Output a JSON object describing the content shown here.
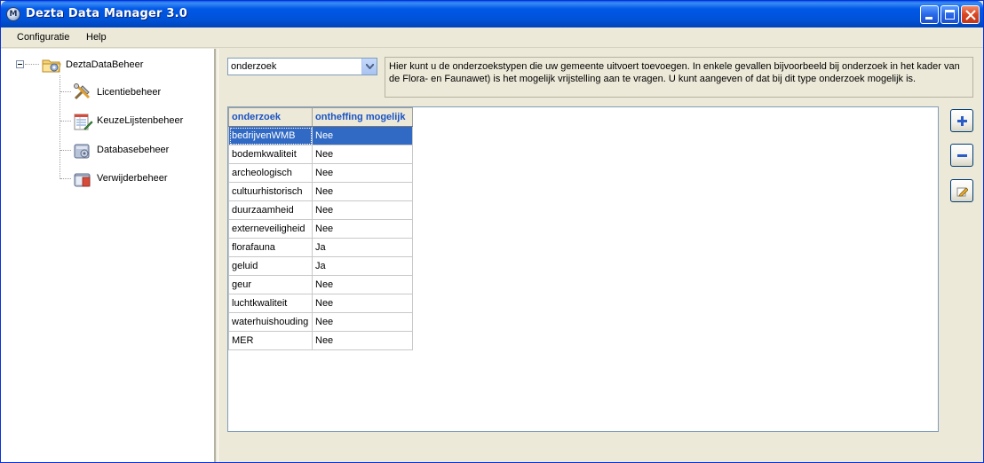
{
  "window": {
    "title": "Dezta Data Manager 3.0",
    "icon_letter": "M"
  },
  "menu": {
    "items": [
      "Configuratie",
      "Help"
    ]
  },
  "tree": {
    "root": "DeztaDataBeheer",
    "children": [
      "Licentiebeheer",
      "KeuzeLijstenbeheer",
      "Databasebeheer",
      "Verwijderbeheer"
    ]
  },
  "type_select": {
    "value": "onderzoek"
  },
  "info_text": "Hier kunt u de onderzoekstypen die uw gemeente uitvoert toevoegen. In enkele gevallen  bijvoorbeeld bij onderzoek in het kader van de Flora- en Faunawet) is het mogelijk vrijstelling aan te vragen. U kunt aangeven of dat bij dit type onderzoek mogelijk is.",
  "grid": {
    "columns": [
      "onderzoek",
      "ontheffing mogelijk"
    ],
    "selected_row": 0,
    "rows": [
      [
        "bedrijvenWMB",
        "Nee"
      ],
      [
        "bodemkwaliteit",
        "Nee"
      ],
      [
        "archeologisch",
        "Nee"
      ],
      [
        "cultuurhistorisch",
        "Nee"
      ],
      [
        "duurzaamheid",
        "Nee"
      ],
      [
        "externeveiligheid",
        "Nee"
      ],
      [
        "florafauna",
        "Ja"
      ],
      [
        "geluid",
        "Ja"
      ],
      [
        "geur",
        "Nee"
      ],
      [
        "luchtkwaliteit",
        "Nee"
      ],
      [
        "waterhuishouding",
        "Nee"
      ],
      [
        "MER",
        "Nee"
      ]
    ]
  },
  "buttons": {
    "add_icon": "plus-icon",
    "remove_icon": "minus-icon",
    "edit_icon": "pencil-edit-icon"
  },
  "colors": {
    "titlebar": "#0058e6",
    "selection": "#316ac5",
    "header_text": "#1a52c4"
  }
}
